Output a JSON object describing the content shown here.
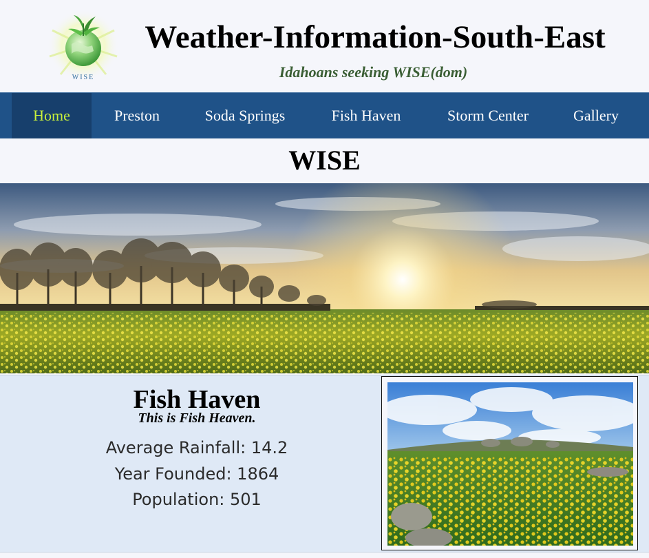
{
  "header": {
    "title": "Weather-Information-South-East",
    "tagline": "Idahoans seeking WISE(dom)",
    "logo_text": "WISE"
  },
  "nav": {
    "items": [
      {
        "label": "Home",
        "active": true
      },
      {
        "label": "Preston",
        "active": false
      },
      {
        "label": "Soda Springs",
        "active": false
      },
      {
        "label": "Fish Haven",
        "active": false
      },
      {
        "label": "Storm Center",
        "active": false
      },
      {
        "label": "Gallery",
        "active": false
      }
    ],
    "active_color": "#c8f03c",
    "background": "#1f5288"
  },
  "page_heading": "WISE",
  "city": {
    "name": "Fish Haven",
    "motto": "This is Fish Heaven.",
    "stats": [
      "Average Rainfall: 14.2",
      "Year Founded: 1864",
      "Population: 501"
    ]
  },
  "images": {
    "hero": "sunset-over-rapeseed-field",
    "city_photo": "yellow-flower-meadow-under-blue-sky"
  }
}
